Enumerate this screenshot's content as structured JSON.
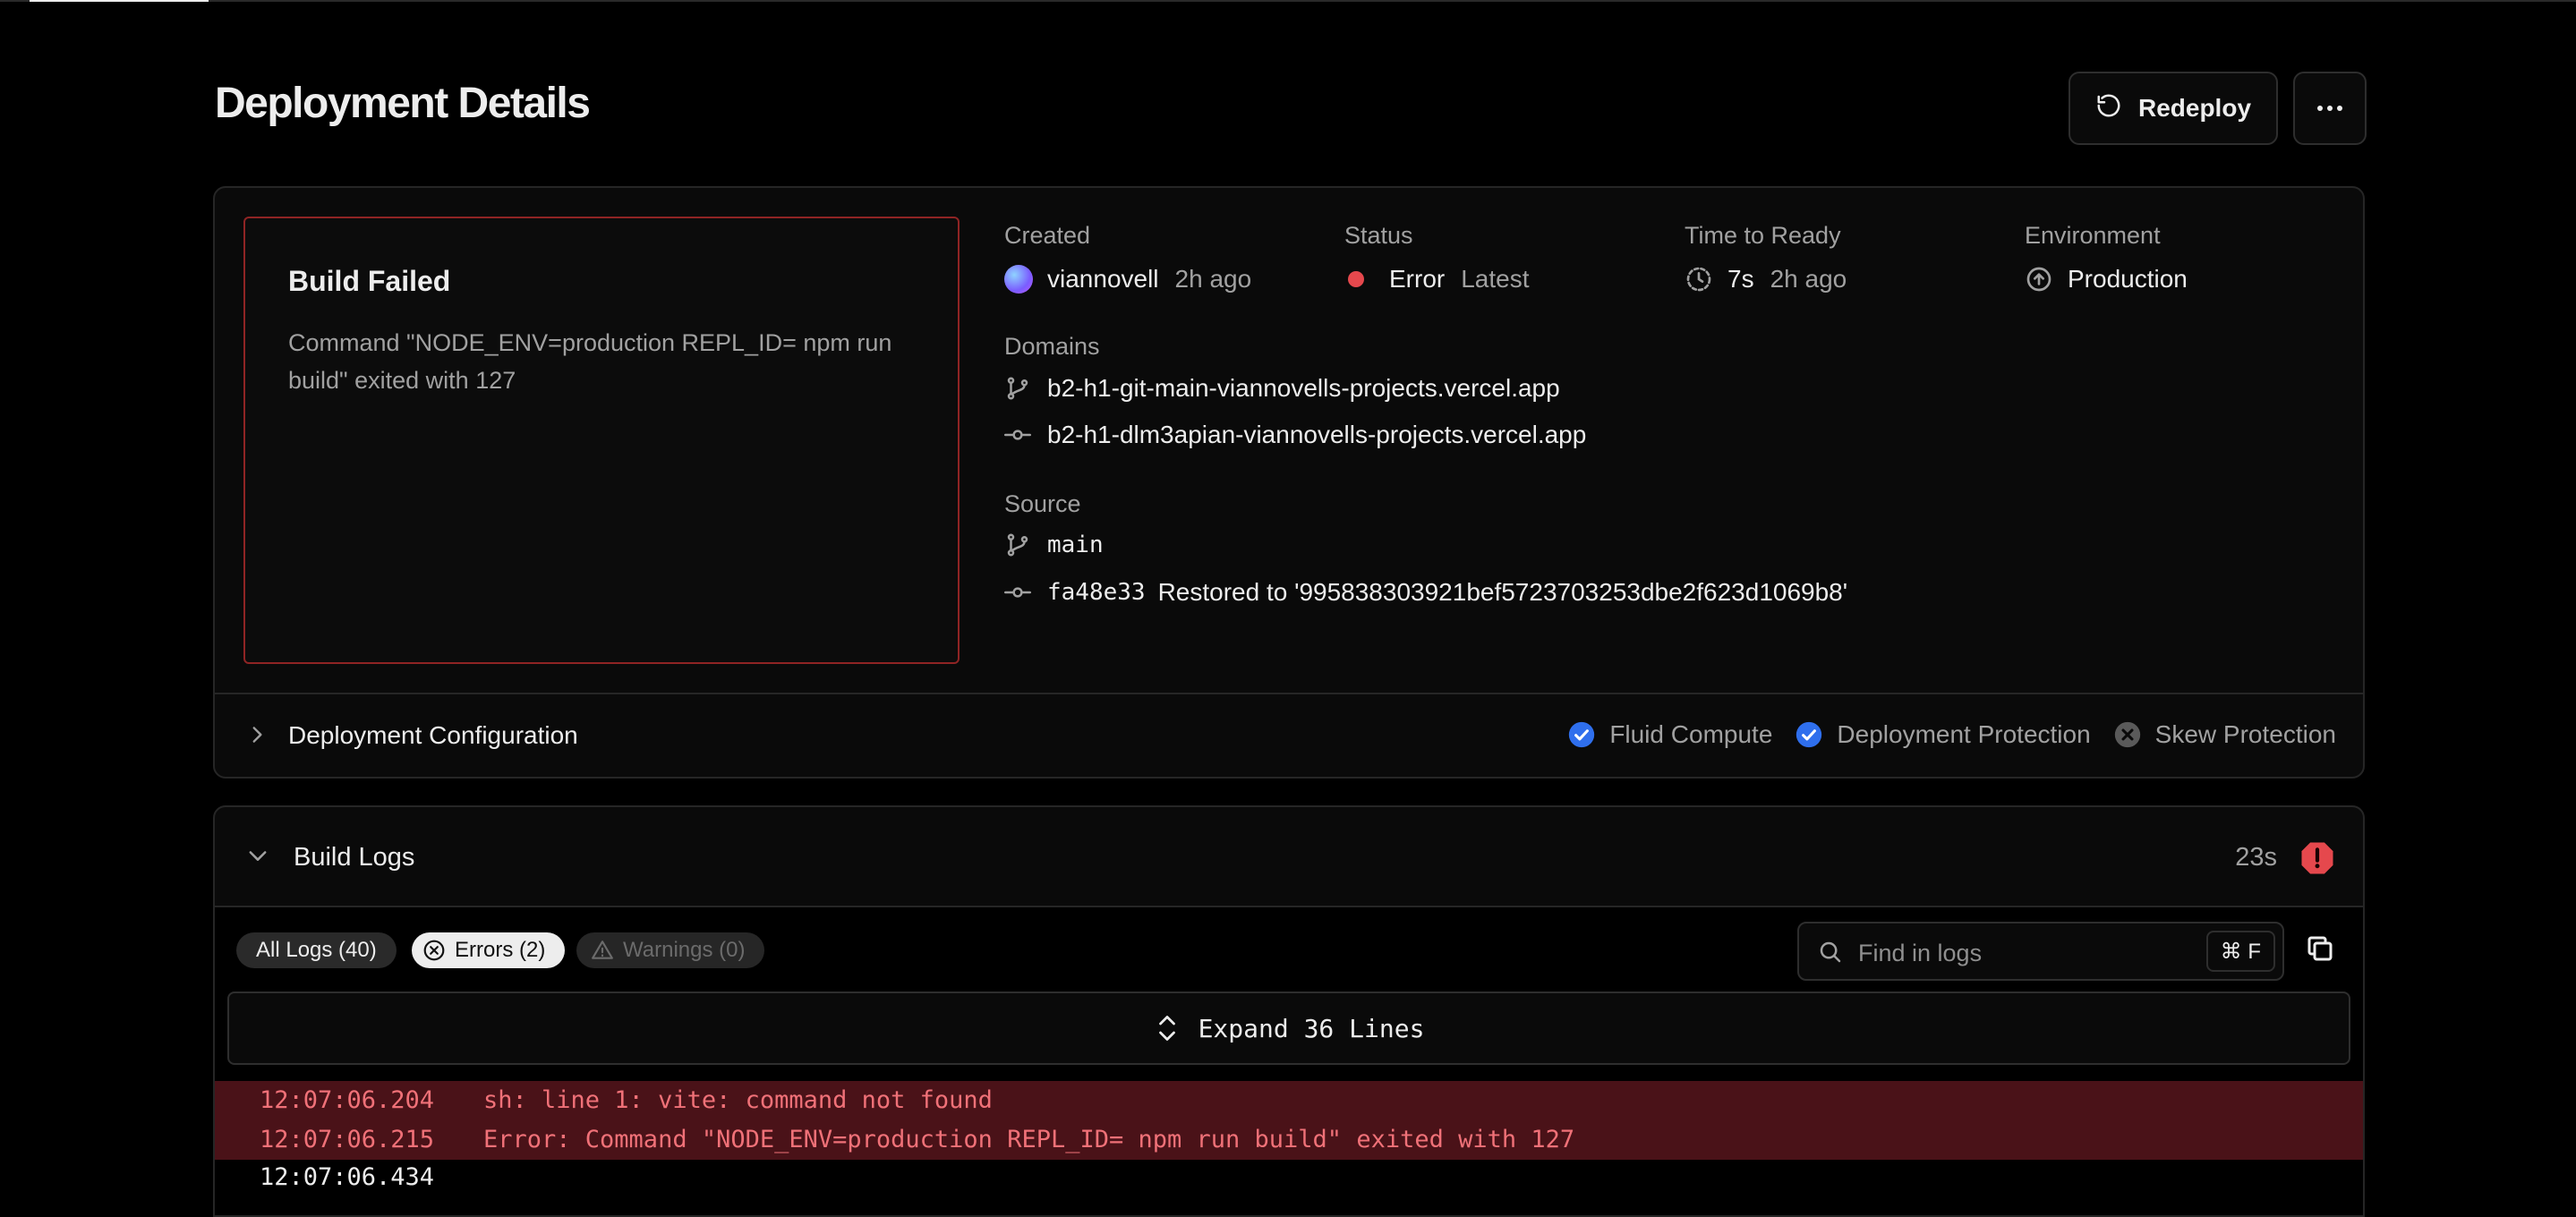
{
  "page": {
    "title": "Deployment Details",
    "redeploy_label": "Redeploy"
  },
  "build_status": {
    "title": "Build Failed",
    "message": "Command \"NODE_ENV=production REPL_ID= npm run build\" exited with 127"
  },
  "meta": {
    "created": {
      "label": "Created",
      "user": "viannovell",
      "time": "2h ago"
    },
    "status": {
      "label": "Status",
      "value": "Error",
      "tag": "Latest",
      "color": "#e5484d"
    },
    "time_to_ready": {
      "label": "Time to Ready",
      "value": "7s",
      "time": "2h ago"
    },
    "environment": {
      "label": "Environment",
      "value": "Production"
    },
    "domains": {
      "label": "Domains",
      "items": [
        {
          "icon": "git-branch-icon",
          "text": "b2-h1-git-main-viannovells-projects.vercel.app"
        },
        {
          "icon": "git-commit-icon",
          "text": "b2-h1-dlm3apian-viannovells-projects.vercel.app"
        }
      ]
    },
    "source": {
      "label": "Source",
      "branch": "main",
      "commit_hash": "fa48e33",
      "commit_message": "Restored to '995838303921bef5723703253dbe2f623d1069b8'"
    }
  },
  "config": {
    "title": "Deployment Configuration",
    "badges": [
      {
        "label": "Fluid Compute",
        "enabled": true
      },
      {
        "label": "Deployment Protection",
        "enabled": true
      },
      {
        "label": "Skew Protection",
        "enabled": false
      }
    ]
  },
  "logs": {
    "title": "Build Logs",
    "duration": "23s",
    "filters": {
      "all": "All Logs (40)",
      "errors": "Errors (2)",
      "warnings": "Warnings (0)"
    },
    "search_placeholder": "Find in logs",
    "shortcut": "⌘ F",
    "expand_label": "Expand 36 Lines",
    "lines": [
      {
        "time": "12:07:06.204",
        "text": "sh: line 1: vite: command not found",
        "level": "error"
      },
      {
        "time": "12:07:06.215",
        "text": "Error: Command \"NODE_ENV=production REPL_ID= npm run build\" exited with 127",
        "level": "error"
      },
      {
        "time": "12:07:06.434",
        "text": "",
        "level": "info"
      }
    ]
  },
  "colors": {
    "accent_blue": "#2f6fed",
    "error_red": "#e5484d",
    "fail_border": "#8f2424"
  }
}
